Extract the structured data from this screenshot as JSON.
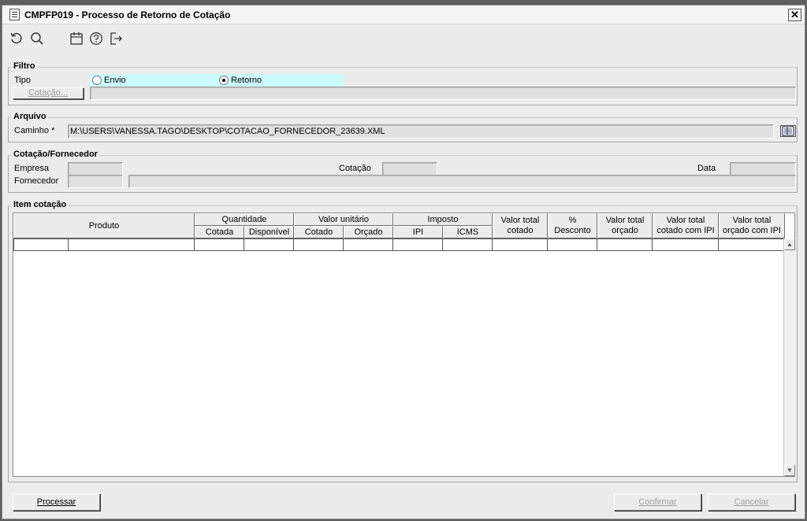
{
  "window": {
    "title": "CMPFP019 - Processo de Retorno de Cotação",
    "close_label": "✕"
  },
  "toolbar": {
    "icons": [
      "undo-icon",
      "search-icon",
      "calendar-icon",
      "help-icon",
      "exit-icon"
    ]
  },
  "filtro": {
    "legend": "Filtro",
    "tipo_label": "Tipo",
    "option_envio": "Envio",
    "option_retorno": "Retorno",
    "selected": "Retorno",
    "cotacao_button": "Cotação...",
    "cotacao_value": ""
  },
  "arquivo": {
    "legend": "Arquivo",
    "caminho_label": "Caminho *",
    "caminho_value": "M:\\USERS\\VANESSA.TAGO\\DESKTOP\\COTACAO_FORNECEDOR_23639.XML"
  },
  "cotacao_fornecedor": {
    "legend": "Cotação/Fornecedor",
    "empresa_label": "Empresa",
    "cotacao_label": "Cotação",
    "data_label": "Data",
    "fornecedor_label": "Fornecedor",
    "empresa_value": "",
    "cotacao_value": "",
    "data_value": "",
    "fornecedor_code": "",
    "fornecedor_name": ""
  },
  "item_cotacao": {
    "legend": "Item cotação",
    "headers": {
      "produto": "Produto",
      "quantidade": "Quantidade",
      "cotada": "Cotada",
      "disponivel": "Disponível",
      "valor_unitario": "Valor unitário",
      "cotado": "Cotado",
      "orcado": "Orçado",
      "imposto": "Imposto",
      "ipi": "IPI",
      "icms": "ICMS",
      "valor_total_cotado_1": "Valor total",
      "valor_total_cotado_2": "cotado",
      "desconto_1": "%",
      "desconto_2": "Desconto",
      "valor_total_orcado_1": "Valor total",
      "valor_total_orcado_2": "orçado",
      "vt_cotado_ipi_1": "Valor total",
      "vt_cotado_ipi_2": "cotado com IPI",
      "vt_orcado_ipi_1": "Valor total",
      "vt_orcado_ipi_2": "orçado com IPI"
    },
    "rows": []
  },
  "footer": {
    "processar": "Processar",
    "confirmar": "Confirmar",
    "cancelar": "Cancelar"
  }
}
